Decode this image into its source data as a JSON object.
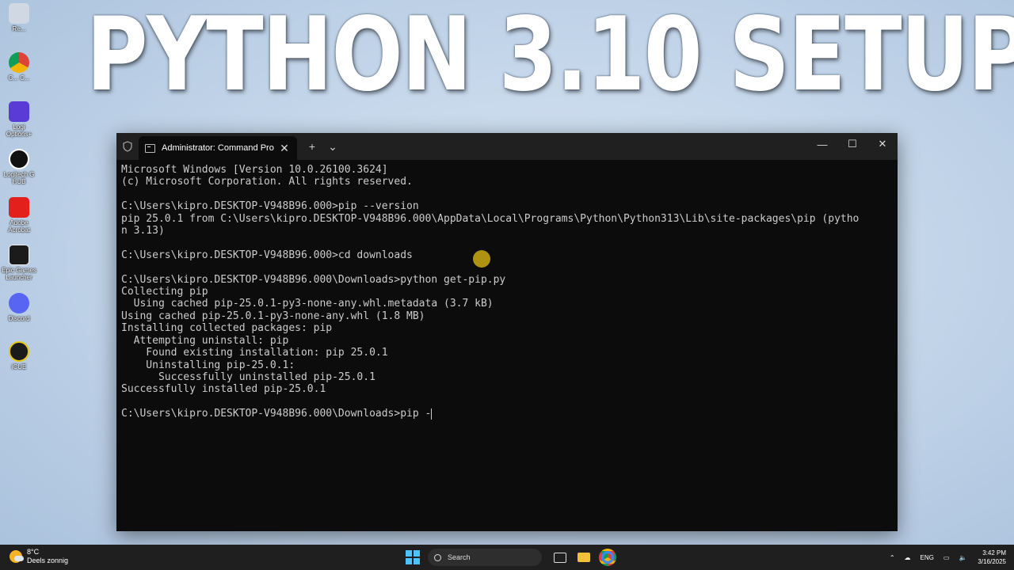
{
  "headline": "PYTHON 3.10 SETUP",
  "desktop_icons": [
    {
      "label": "Re...",
      "icon": "recycle-bin-icon"
    },
    {
      "label": "C... C...",
      "icon": "chrome-icon"
    },
    {
      "label": "Logi Options+",
      "icon": "logi-options-icon"
    },
    {
      "label": "Logitech G HUB",
      "icon": "logitech-g-hub-icon"
    },
    {
      "label": "Adobe Acrobat",
      "icon": "adobe-acrobat-icon"
    },
    {
      "label": "Epic Games Launcher",
      "icon": "epic-games-icon"
    },
    {
      "label": "Discord",
      "icon": "discord-icon"
    },
    {
      "label": "iCUE",
      "icon": "icue-icon"
    }
  ],
  "window": {
    "tab_title": "Administrator: Command Pro",
    "new_tab": "+",
    "dropdown": "⌄",
    "close_tab": "✕",
    "minimize": "—",
    "maximize": "☐",
    "close": "✕"
  },
  "terminal_lines": [
    "Microsoft Windows [Version 10.0.26100.3624]",
    "(c) Microsoft Corporation. All rights reserved.",
    "",
    "C:\\Users\\kipro.DESKTOP-V948B96.000>pip --version",
    "pip 25.0.1 from C:\\Users\\kipro.DESKTOP-V948B96.000\\AppData\\Local\\Programs\\Python\\Python313\\Lib\\site-packages\\pip (pytho",
    "n 3.13)",
    "",
    "C:\\Users\\kipro.DESKTOP-V948B96.000>cd downloads",
    "",
    "C:\\Users\\kipro.DESKTOP-V948B96.000\\Downloads>python get-pip.py",
    "Collecting pip",
    "  Using cached pip-25.0.1-py3-none-any.whl.metadata (3.7 kB)",
    "Using cached pip-25.0.1-py3-none-any.whl (1.8 MB)",
    "Installing collected packages: pip",
    "  Attempting uninstall: pip",
    "    Found existing installation: pip 25.0.1",
    "    Uninstalling pip-25.0.1:",
    "      Successfully uninstalled pip-25.0.1",
    "Successfully installed pip-25.0.1",
    ""
  ],
  "prompt_line": "C:\\Users\\kipro.DESKTOP-V948B96.000\\Downloads>pip -",
  "taskbar": {
    "temperature": "8°C",
    "weather": "Deels zonnig",
    "search_placeholder": "Search",
    "language": "ENG",
    "time": "3:42 PM",
    "date": "3/16/2025"
  },
  "colors": {
    "terminal_bg": "#0c0c0c",
    "terminal_fg": "#cccccc",
    "titlebar_bg": "#202020",
    "taskbar_bg": "#1f1f1f",
    "accent": "#4cc2ff"
  }
}
